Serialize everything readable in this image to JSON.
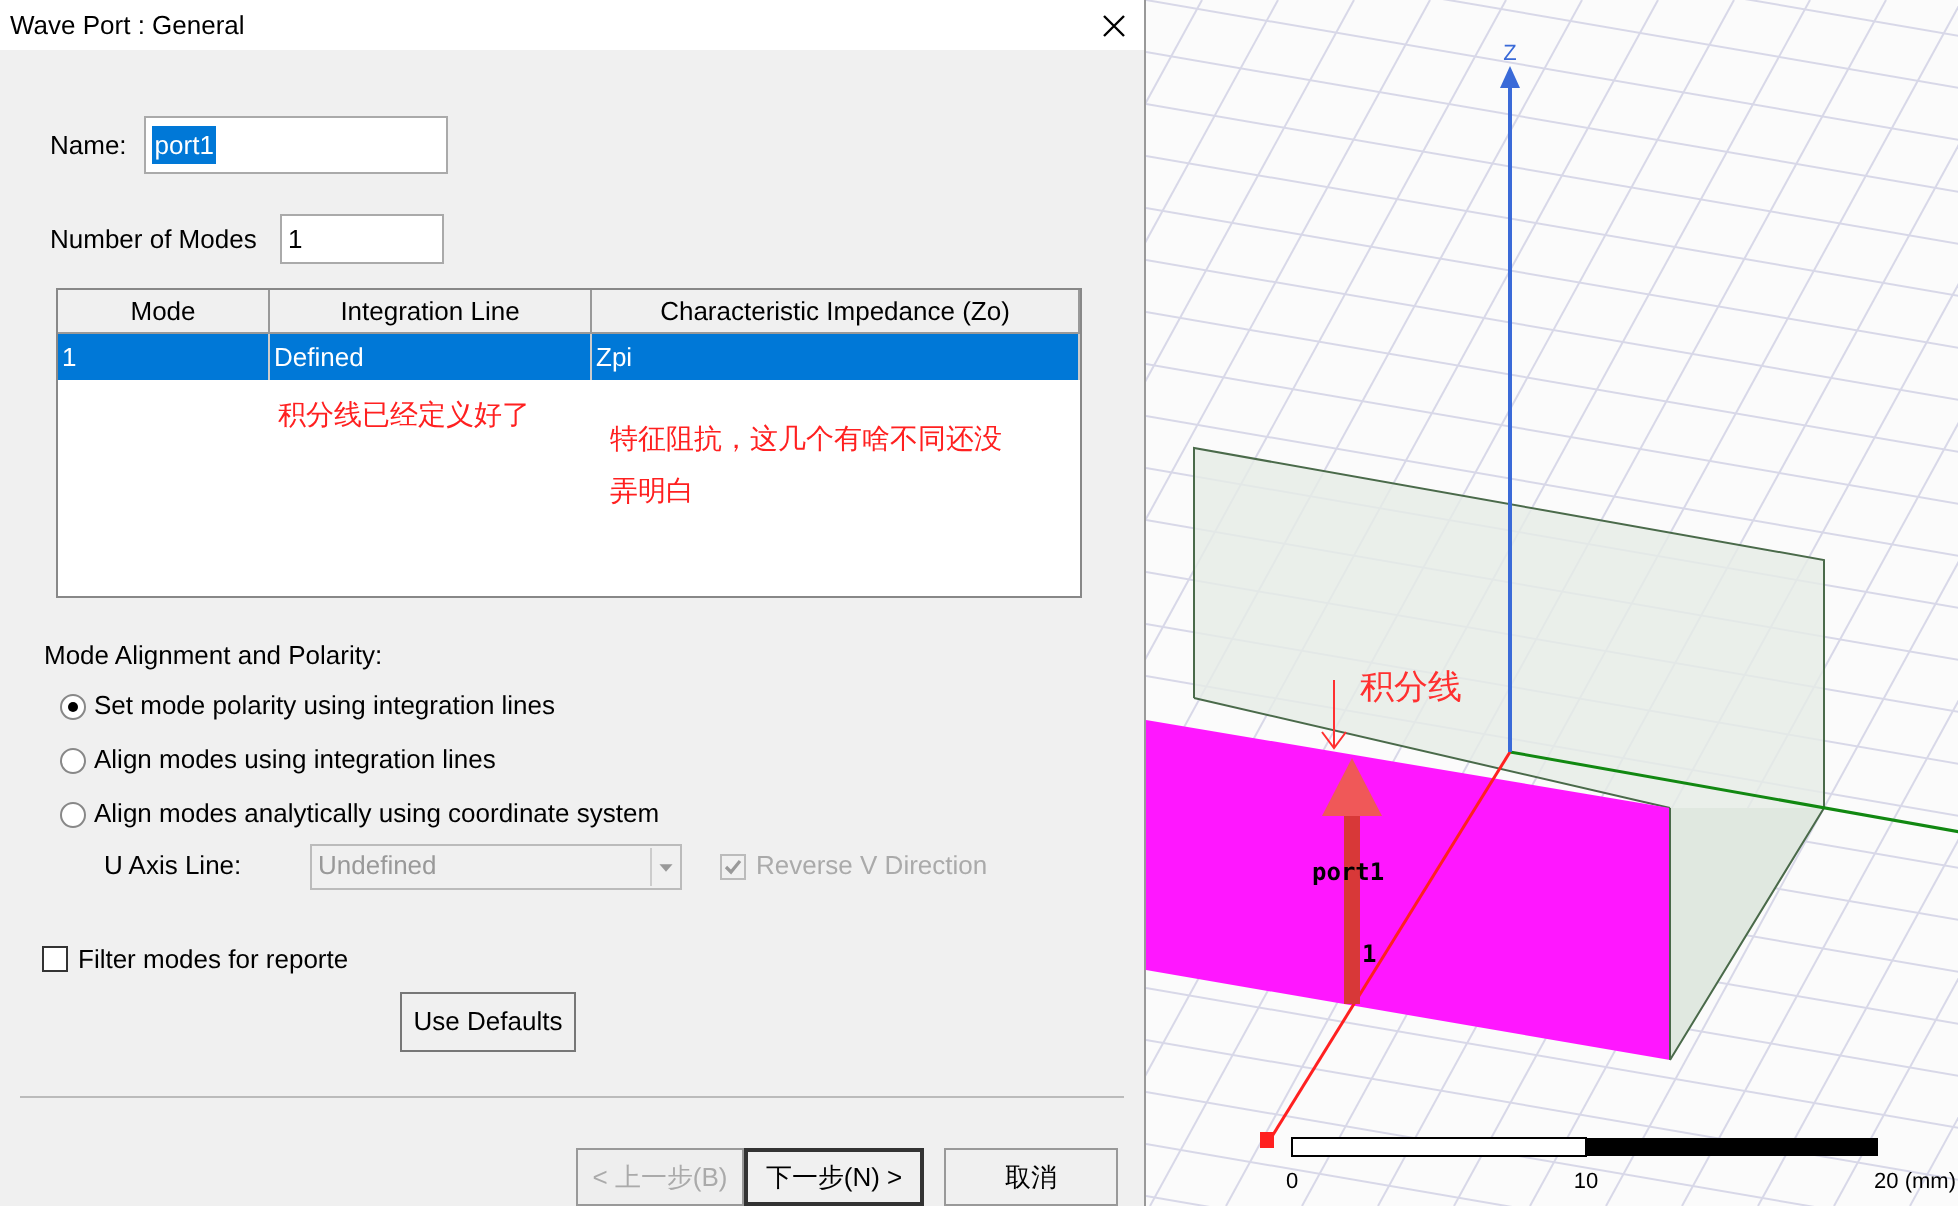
{
  "dialog": {
    "title": "Wave Port : General",
    "name_field": {
      "label": "Name:",
      "value": "port1"
    },
    "modes_field": {
      "label": "Number of Modes",
      "value": "1"
    },
    "table": {
      "columns": [
        "Mode",
        "Integration Line",
        "Characteristic Impedance (Zo)"
      ],
      "rows": [
        {
          "cells": [
            "1",
            "Defined",
            "Zpi"
          ],
          "selected": true
        }
      ]
    },
    "notes": [
      {
        "text": "积分线已经定义好了"
      },
      {
        "text": "特征阻抗，这几个有啥不同还没弄明白"
      }
    ],
    "alignment": {
      "title": "Mode Alignment and Polarity:",
      "options": [
        {
          "label": "Set mode polarity using integration lines",
          "selected": true
        },
        {
          "label": "Align modes using integration lines",
          "selected": false
        },
        {
          "label": "Align modes analytically using coordinate system",
          "selected": false
        }
      ],
      "u_axis": {
        "label": "U Axis Line:",
        "value": "Undefined",
        "disabled": true
      },
      "reverse_v": {
        "label": "Reverse V Direction",
        "checked": true,
        "disabled": true
      }
    },
    "filter": {
      "label": "Filter modes for reporte",
      "checked": false
    },
    "use_defaults": "Use Defaults",
    "buttons": [
      {
        "label": "< 上一步(B)",
        "disabled": true,
        "default": false
      },
      {
        "label": "下一步(N) >",
        "disabled": false,
        "default": true
      },
      {
        "label": "取消",
        "disabled": false,
        "default": false
      }
    ]
  },
  "viewport": {
    "axis_label": "Z",
    "port_label": "port1",
    "mode_label": "1",
    "note": "积分线",
    "scale_ticks": [
      "0",
      "10",
      "20 (mm)"
    ]
  }
}
